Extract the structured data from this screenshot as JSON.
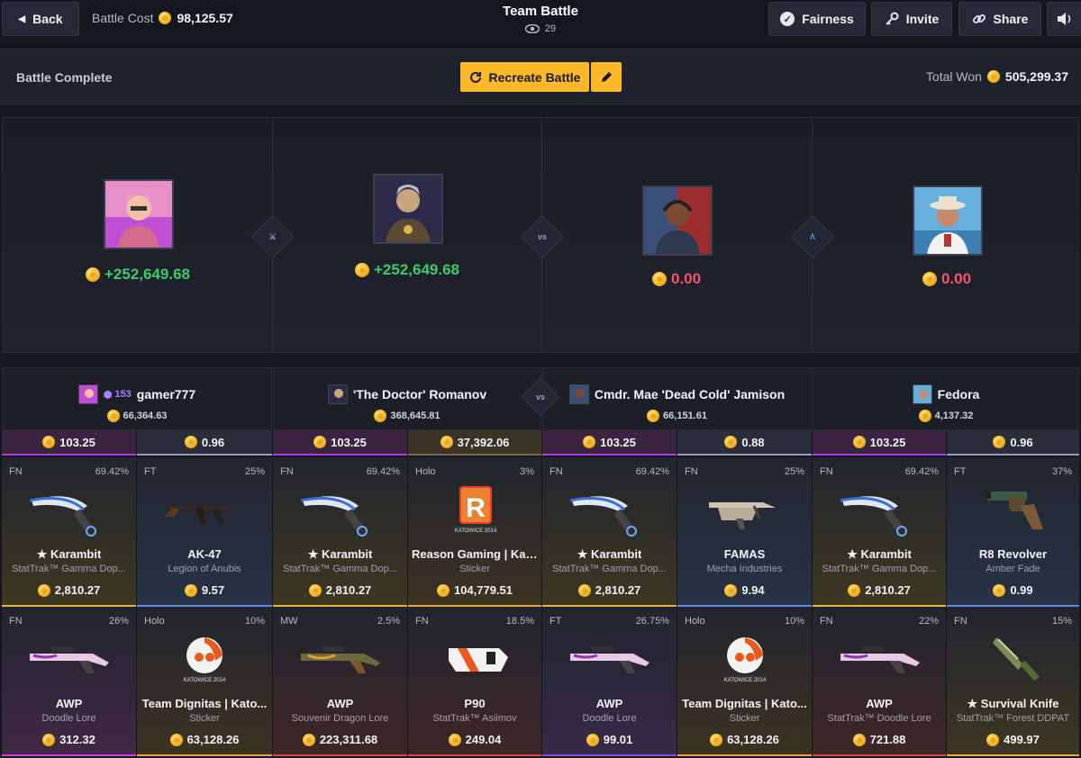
{
  "header": {
    "back_label": "Back",
    "cost_label": "Battle Cost",
    "cost_value": "98,125.57",
    "title": "Team Battle",
    "viewers": "29",
    "fairness_label": "Fairness",
    "invite_label": "Invite",
    "share_label": "Share"
  },
  "status": {
    "label": "Battle Complete",
    "recreate_label": "Recreate Battle",
    "total_label": "Total Won",
    "total_value": "505,299.37"
  },
  "arena": {
    "vs_label": "vs",
    "players": [
      {
        "amount": "+252,649.68",
        "result": "win"
      },
      {
        "amount": "+252,649.68",
        "result": "win"
      },
      {
        "amount": "0.00",
        "result": "loss"
      },
      {
        "amount": "0.00",
        "result": "loss"
      }
    ]
  },
  "players": [
    {
      "name": "gamer777",
      "level": "153",
      "value": "66,364.63"
    },
    {
      "name": "'The Doctor' Romanov",
      "value": "368,645.81"
    },
    {
      "name": "Cmdr. Mae 'Dead Cold' Jamison",
      "value": "66,151.61"
    },
    {
      "name": "Fedora",
      "value": "4,137.32"
    }
  ],
  "cases": [
    "103.25",
    "0.96",
    "103.25",
    "37,392.06",
    "103.25",
    "0.88",
    "103.25",
    "0.96"
  ],
  "items_row1": [
    {
      "wear": "FN",
      "pct": "69.42%",
      "name": "★ Karambit",
      "sub": "StatTrak™ Gamma Dop...",
      "price": "2,810.27"
    },
    {
      "wear": "FT",
      "pct": "25%",
      "name": "AK-47",
      "sub": "Legion of Anubis",
      "price": "9.57"
    },
    {
      "wear": "FN",
      "pct": "69.42%",
      "name": "★ Karambit",
      "sub": "StatTrak™ Gamma Dop...",
      "price": "2,810.27"
    },
    {
      "wear": "Holo",
      "pct": "3%",
      "name": "Reason Gaming | Kat...",
      "sub": "Sticker",
      "price": "104,779.51"
    },
    {
      "wear": "FN",
      "pct": "69.42%",
      "name": "★ Karambit",
      "sub": "StatTrak™ Gamma Dop...",
      "price": "2,810.27"
    },
    {
      "wear": "FN",
      "pct": "25%",
      "name": "FAMAS",
      "sub": "Mecha Industries",
      "price": "9.94"
    },
    {
      "wear": "FN",
      "pct": "69.42%",
      "name": "★ Karambit",
      "sub": "StatTrak™ Gamma Dop...",
      "price": "2,810.27"
    },
    {
      "wear": "FT",
      "pct": "37%",
      "name": "R8 Revolver",
      "sub": "Amber Fade",
      "price": "0.99"
    }
  ],
  "items_row2": [
    {
      "wear": "FN",
      "pct": "26%",
      "name": "AWP",
      "sub": "Doodle Lore",
      "price": "312.32"
    },
    {
      "wear": "Holo",
      "pct": "10%",
      "name": "Team Dignitas | Kato...",
      "sub": "Sticker",
      "price": "63,128.26"
    },
    {
      "wear": "MW",
      "pct": "2.5%",
      "name": "AWP",
      "sub": "Souvenir Dragon Lore",
      "price": "223,311.68"
    },
    {
      "wear": "FN",
      "pct": "18.5%",
      "name": "P90",
      "sub": "StatTrak™ Asiimov",
      "price": "249.04"
    },
    {
      "wear": "FT",
      "pct": "26.75%",
      "name": "AWP",
      "sub": "Doodle Lore",
      "price": "99.01"
    },
    {
      "wear": "Holo",
      "pct": "10%",
      "name": "Team Dignitas | Kato...",
      "sub": "Sticker",
      "price": "63,128.26"
    },
    {
      "wear": "FN",
      "pct": "22%",
      "name": "AWP",
      "sub": "StatTrak™ Doodle Lore",
      "price": "721.88"
    },
    {
      "wear": "FN",
      "pct": "15%",
      "name": "★ Survival Knife",
      "sub": "StatTrak™ Forest DDPAT",
      "price": "499.97"
    }
  ],
  "sticker_text": {
    "reason": "KATOWICE 2014",
    "dignitas": "KATOWICE 2014"
  }
}
